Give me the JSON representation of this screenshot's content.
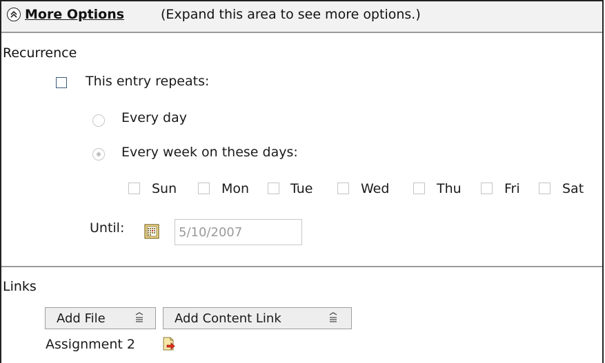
{
  "header": {
    "link": "More Options",
    "hint": "(Expand this area to see more options.)"
  },
  "recurrence": {
    "section_label": "Recurrence",
    "repeats_label": "This entry repeats:",
    "repeats_checked": false,
    "option_every_day": "Every day",
    "option_every_week": "Every week on these days:",
    "days": [
      "Sun",
      "Mon",
      "Tue",
      "Wed",
      "Thu",
      "Fri",
      "Sat"
    ],
    "until_label": "Until:",
    "until_value": "5/10/2007"
  },
  "links": {
    "section_label": "Links",
    "add_file": "Add File",
    "add_content_link": "Add Content Link",
    "items": [
      {
        "label": "Assignment 2",
        "icon": "open-file-icon"
      }
    ]
  },
  "colors": {
    "header_bg": "#f2f2f2",
    "divider": "#9a9a9a",
    "disabled": "#c4c4c4",
    "text": "#1a1a1a"
  }
}
